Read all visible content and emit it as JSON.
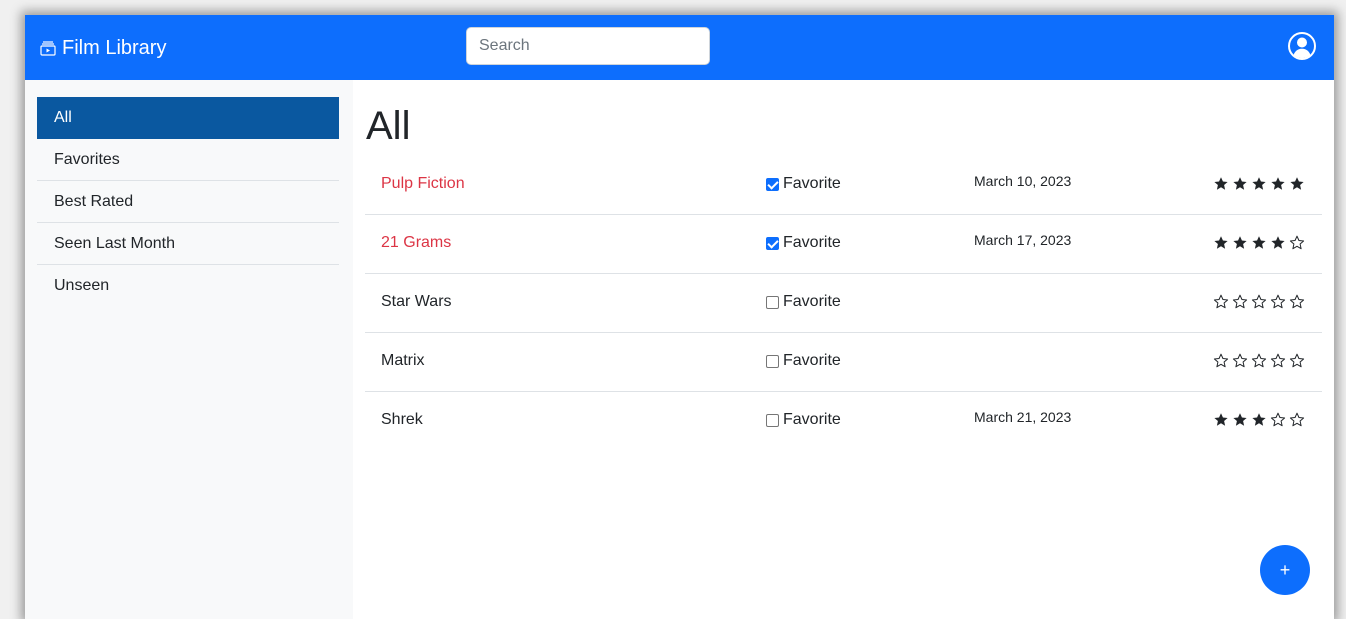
{
  "navbar": {
    "brand": "Film Library",
    "search_placeholder": "Search"
  },
  "sidebar": {
    "items": [
      {
        "label": "All",
        "active": true
      },
      {
        "label": "Favorites",
        "active": false
      },
      {
        "label": "Best Rated",
        "active": false
      },
      {
        "label": "Seen Last Month",
        "active": false
      },
      {
        "label": "Unseen",
        "active": false
      }
    ]
  },
  "main": {
    "title": "All",
    "favorite_label": "Favorite",
    "films": [
      {
        "title": "Pulp Fiction",
        "favorite": true,
        "date": "March 10, 2023",
        "rating": 5
      },
      {
        "title": "21 Grams",
        "favorite": true,
        "date": "March 17, 2023",
        "rating": 4
      },
      {
        "title": "Star Wars",
        "favorite": false,
        "date": "",
        "rating": 0
      },
      {
        "title": "Matrix",
        "favorite": false,
        "date": "",
        "rating": 0
      },
      {
        "title": "Shrek",
        "favorite": false,
        "date": "March 21, 2023",
        "rating": 3
      }
    ],
    "add_label": "+"
  },
  "colors": {
    "primary": "#0d6efd",
    "sidebar_active": "#0a58a0",
    "favorite_title": "#dc3545",
    "text": "#212529"
  },
  "icons": {
    "brand": "collection-play-icon",
    "user": "person-circle-icon",
    "star_filled": "star-fill-icon",
    "star_empty": "star-icon"
  }
}
